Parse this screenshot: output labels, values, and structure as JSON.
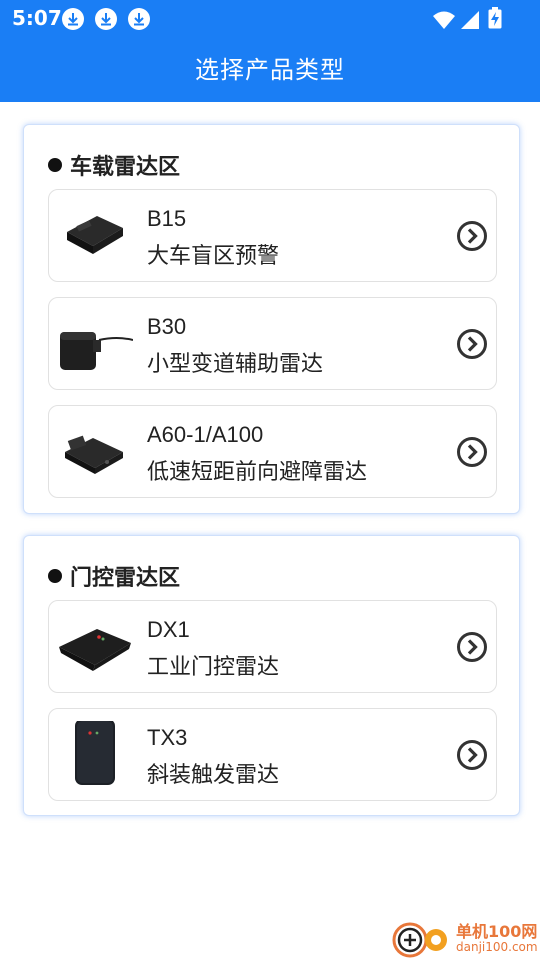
{
  "status_bar": {
    "time": "5:07"
  },
  "header": {
    "title": "选择产品类型"
  },
  "sections": [
    {
      "title": "车载雷达区",
      "items": [
        {
          "name": "B15",
          "desc": "大车盲区预警"
        },
        {
          "name": "B30",
          "desc": "小型变道辅助雷达"
        },
        {
          "name": "A60-1/A100",
          "desc": "低速短距前向避障雷达"
        }
      ]
    },
    {
      "title": "门控雷达区",
      "items": [
        {
          "name": "DX1",
          "desc": "工业门控雷达"
        },
        {
          "name": "TX3",
          "desc": "斜装触发雷达"
        }
      ]
    }
  ],
  "watermark": {
    "line1": "单机100网",
    "line2": "danji100.com"
  },
  "colors": {
    "accent": "#1a7ef5",
    "card_border": "#cfe0fb",
    "watermark": "#e8773a"
  }
}
